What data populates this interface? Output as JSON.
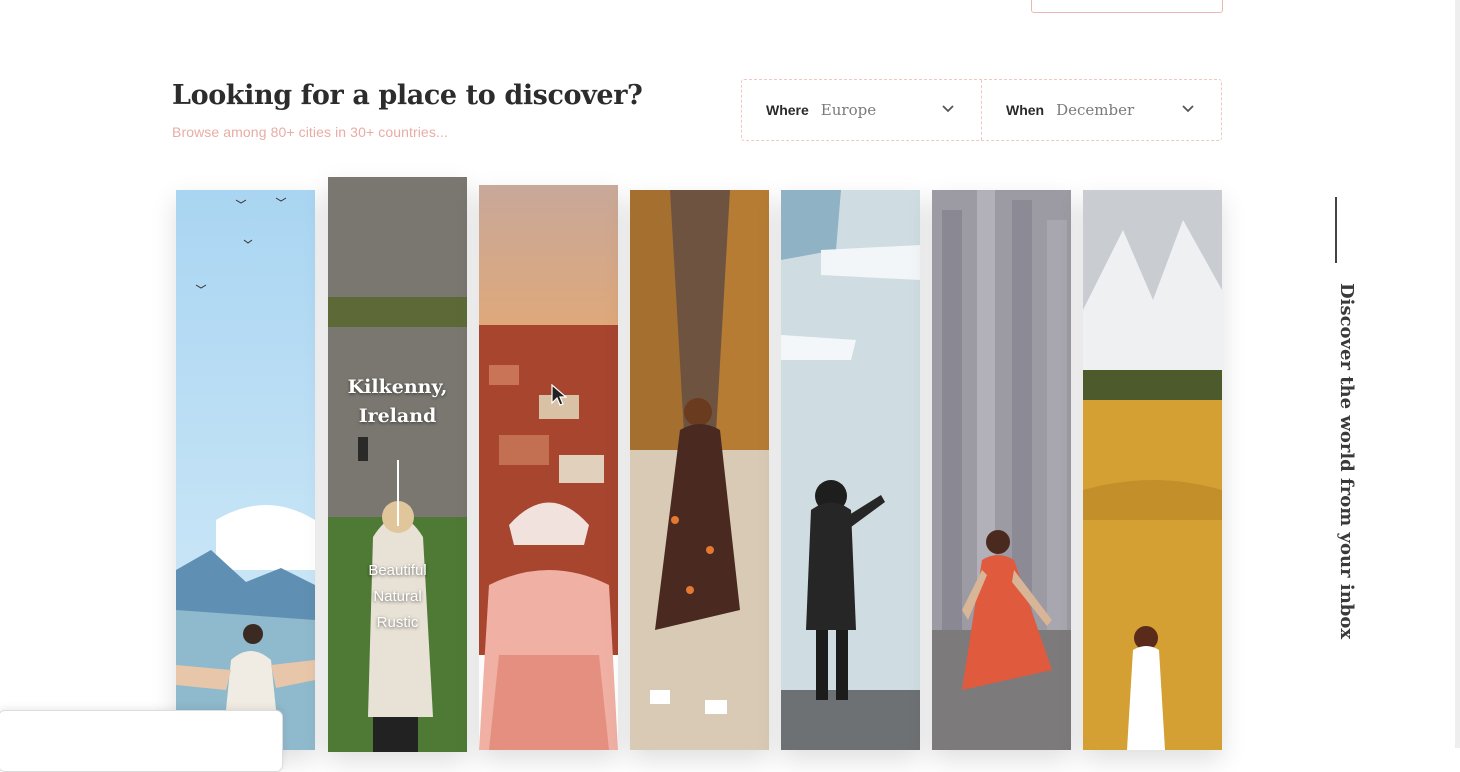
{
  "header": {
    "title": "Looking for a place to discover?",
    "subtitle": "Browse among 80+ cities in 30+ countries..."
  },
  "filters": [
    {
      "label": "Where",
      "value": "Europe"
    },
    {
      "label": "When",
      "value": "December"
    }
  ],
  "cards": [
    {
      "scene": "coast-mountains"
    },
    {
      "scene": "castle-grass",
      "title_line1": "Kilkenny,",
      "title_line2": "Ireland",
      "tags": [
        "Beautiful",
        "Natural",
        "Rustic"
      ]
    },
    {
      "scene": "city-sunset"
    },
    {
      "scene": "autumn-alley"
    },
    {
      "scene": "glacier-lake"
    },
    {
      "scene": "cathedral"
    },
    {
      "scene": "alpine-meadow"
    }
  ],
  "side": {
    "text": "Discover the world from your inbox"
  },
  "icons": {
    "chevron": "chevron-down-icon",
    "cursor": "mouse-cursor-icon"
  },
  "colors": {
    "accent": "#e8aca6",
    "border": "#f0c8c3",
    "text": "#2a2a2a"
  }
}
